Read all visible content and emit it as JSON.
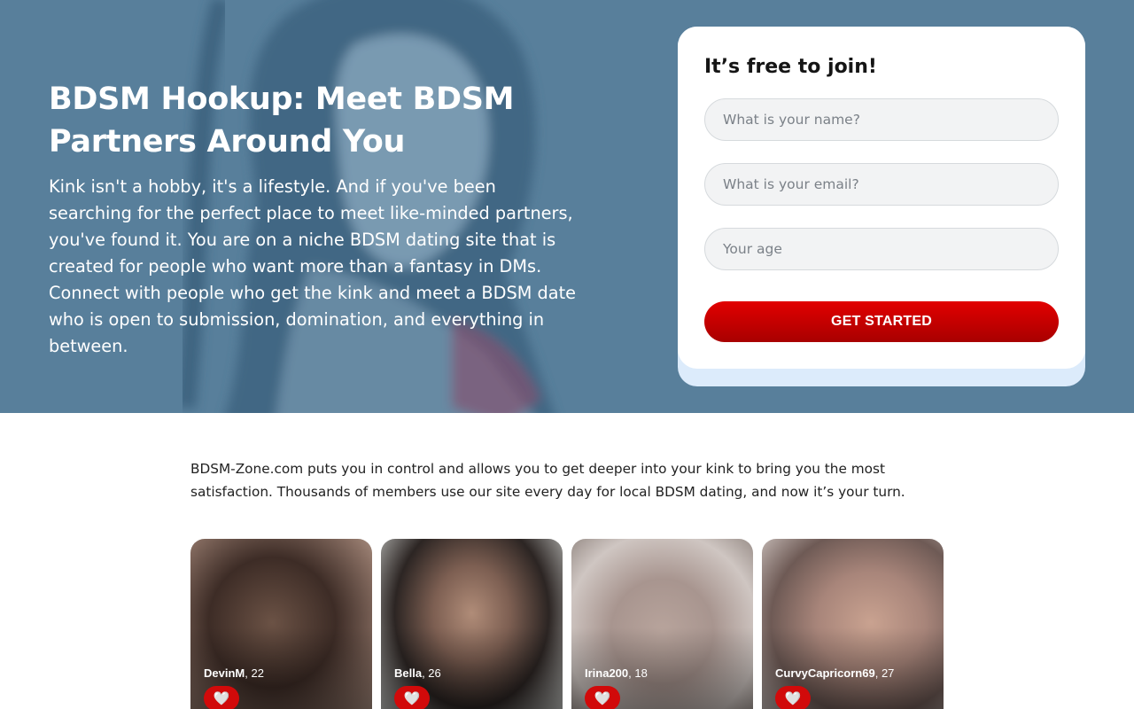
{
  "hero": {
    "title": "BDSM Hookup: Meet BDSM Partners Around You",
    "text": "Kink isn't a hobby, it's a lifestyle. And if you've been searching for the perfect place to meet like-minded partners, you've found it. You are on a niche BDSM dating site that is created for people who want more than a fantasy in DMs. Connect with people who get the kink and meet a BDSM date who is open to submission, domination, and everything in between."
  },
  "signup": {
    "title": "It’s free to join!",
    "name_placeholder": "What is your name?",
    "email_placeholder": "What is your email?",
    "age_placeholder": "Your age",
    "button_label": "GET STARTED"
  },
  "intro": {
    "text": "BDSM-Zone.com puts you in control and allows you to get deeper into your kink to bring you the most satisfaction. Thousands of members use our site every day for local BDSM dating, and now it’s your turn."
  },
  "profiles": [
    {
      "name": "DevinM",
      "age": ", 22"
    },
    {
      "name": "Bella",
      "age": ", 26"
    },
    {
      "name": "Irina200",
      "age": ", 18"
    },
    {
      "name": "CurvyCapricorn69",
      "age": ", 27"
    }
  ],
  "icons": {
    "like": "heart-icon"
  },
  "colors": {
    "hero_bg": "#587f9b",
    "cta": "#d10a0a",
    "card_accent": "#dcebfb"
  }
}
